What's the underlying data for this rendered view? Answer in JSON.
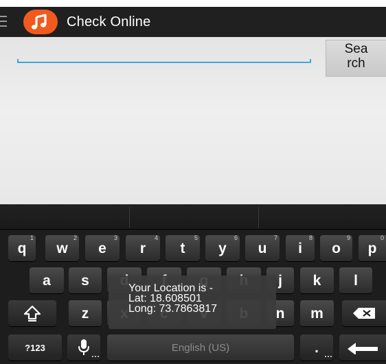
{
  "actionbar": {
    "title": "Check Online"
  },
  "search": {
    "value": "",
    "placeholder": "",
    "button_line1": "Sea",
    "button_line2": "rch"
  },
  "keyboard": {
    "row1": [
      {
        "letter": "q",
        "hint": "1"
      },
      {
        "letter": "w",
        "hint": "2"
      },
      {
        "letter": "e",
        "hint": "3"
      },
      {
        "letter": "r",
        "hint": "4"
      },
      {
        "letter": "t",
        "hint": "5"
      },
      {
        "letter": "y",
        "hint": "6"
      },
      {
        "letter": "u",
        "hint": "7"
      },
      {
        "letter": "i",
        "hint": "8"
      },
      {
        "letter": "o",
        "hint": "9"
      },
      {
        "letter": "p",
        "hint": "0"
      }
    ],
    "row2": [
      "a",
      "s",
      "d",
      "f",
      "g",
      "h",
      "j",
      "k",
      "l"
    ],
    "row3": [
      "z",
      "x",
      "c",
      "v",
      "b",
      "n",
      "m"
    ],
    "symbols_key": "?123",
    "space_label": "English (US)",
    "period_key": "."
  },
  "toast": {
    "line1": "Your Location is -",
    "line2": "Lat: 18.608501",
    "line3": "Long: 73.7863817"
  },
  "colors": {
    "accent": "#39a6d8",
    "app_icon": "#f05a1e",
    "actionbar": "#202020"
  }
}
